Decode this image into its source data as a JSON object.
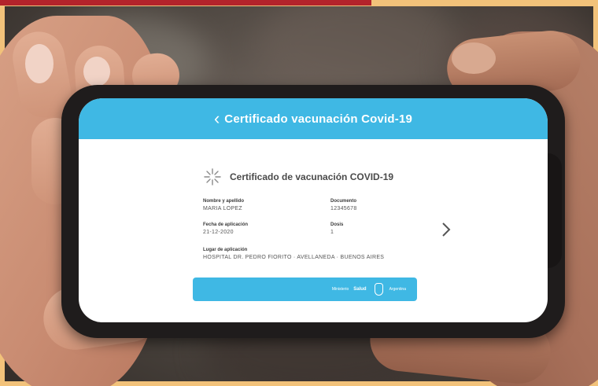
{
  "header": {
    "back_glyph": "‹",
    "title": "Certificado vacunación Covid-19"
  },
  "certificate": {
    "title": "Certificado de vacunación COVID-19",
    "fields": [
      {
        "label": "Nombre y apellido",
        "value": "MARIA LOPEZ"
      },
      {
        "label": "Documento",
        "value": "12345678"
      },
      {
        "label": "Fecha de aplicación",
        "value": "21-12-2020"
      },
      {
        "label": "Dosis",
        "value": "1"
      },
      {
        "label": "Lugar de aplicación",
        "value": "HOSPITAL DR. PEDRO FIORITO · AVELLANEDA · BUENOS AIRES"
      }
    ]
  },
  "footer": {
    "text1": "Ministerio",
    "text2": "Salud",
    "text3": "Argentina"
  },
  "icons": {
    "back": "chevron-left-icon",
    "vaccine": "asterisk-icon",
    "next": "chevron-right-icon",
    "emblem": "national-emblem-icon"
  },
  "colors": {
    "header": "#3fb8e4",
    "phone_body": "#1f1c1c",
    "banner_top": "#b3232b",
    "page_border": "#f2c27a"
  }
}
